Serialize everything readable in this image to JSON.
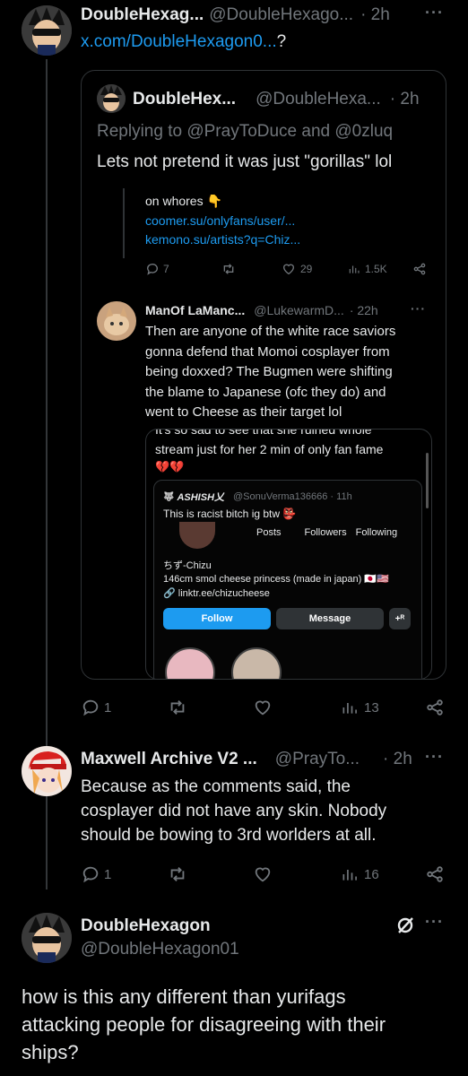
{
  "post1": {
    "name": "DoubleHexag...",
    "handle": "@DoubleHexago...",
    "time": "· 2h",
    "link": "x.com/DoubleHexagon0...",
    "suffix": " ?"
  },
  "quote": {
    "name": "DoubleHex...",
    "handle": "@DoubleHexa...",
    "time": "· 2h",
    "replying": "Replying to @PrayToDuce and @0zluq",
    "text": "Lets not pretend it was just \"gorillas\" lol",
    "inner": {
      "line1": "on whores 👇",
      "link1": "coomer.su/onlyfans/user/...",
      "link2": "kemono.su/artists?q=Chiz..."
    },
    "actions": {
      "replies": "7",
      "likes": "29",
      "views": "1.5K"
    },
    "reply": {
      "name": "ManOf LaManc...",
      "handle": "@LukewarmD...",
      "time": "· 22h",
      "lines": [
        "Then are anyone of the white race saviors",
        "gonna defend that Momoi cosplayer from",
        "being doxxed? The Bugmen were shifting",
        "the blame to Japanese (ofc they do) and",
        "went to Cheese as their target lol"
      ]
    },
    "image": {
      "cut_line": "It's so sad to see that she ruined whole",
      "line2": "stream just for her 2 min of only fan fame",
      "hearts": "💔💔",
      "nested": {
        "name": "ASHISH乂",
        "handle": "@SonuVerma136666 · 11h",
        "text": "This is racist bitch ig btw 👺",
        "stats": [
          "Posts",
          "Followers",
          "Following"
        ],
        "profile_name": "ちず-Chizu",
        "bio": "146cm smol cheese princess (made in japan) 🇯🇵🇺🇸",
        "link": "🔗 linktr.ee/chizucheese",
        "follow": "Follow",
        "message": "Message"
      }
    }
  },
  "post1_actions": {
    "replies": "1",
    "views": "13"
  },
  "post2": {
    "name": "Maxwell Archive V2 ...",
    "handle": "@PrayTo...",
    "time": "· 2h",
    "lines": [
      "Because as the comments said, the",
      "cosplayer did not have any skin. Nobody",
      "should be bowing to 3rd worlders at all."
    ],
    "actions": {
      "replies": "1",
      "views": "16"
    }
  },
  "post3": {
    "name": "DoubleHexagon",
    "handle": "@DoubleHexagon01",
    "lines": [
      "how is this any different than yurifags",
      "attacking people for disagreeing with their",
      "ships?"
    ]
  },
  "colors": {
    "accent": "#1d9bf0",
    "muted": "#71767b",
    "border": "#2f3336",
    "heart": "#f91880"
  }
}
